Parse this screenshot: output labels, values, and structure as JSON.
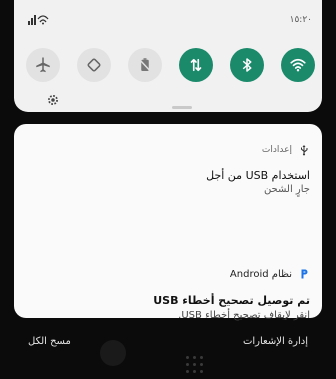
{
  "status_bar": {
    "signal_label": "ıl",
    "wifi_glyph": "📶",
    "time": "١٥:٢٠"
  },
  "quick_settings": {
    "tiles": [
      {
        "name": "airplane-mode",
        "state": "off"
      },
      {
        "name": "auto-rotate",
        "state": "off"
      },
      {
        "name": "battery-saver",
        "state": "off"
      },
      {
        "name": "mobile-data",
        "state": "on"
      },
      {
        "name": "bluetooth",
        "state": "on"
      },
      {
        "name": "wifi",
        "state": "on"
      }
    ],
    "accent_color": "#1b8a6b"
  },
  "notifications": {
    "usb": {
      "app_label": "إعدادات",
      "title": "استخدام USB من أجل",
      "subtitle": "جارٍ الشحن"
    },
    "debug": {
      "app_label": "نظام Android",
      "title": "تم توصيل تصحيح أخطاء USB",
      "subtitle": "انقر لإيقاف تصحيح أخطاء USB."
    }
  },
  "actions": {
    "clear_all": "مسح الكل",
    "manage": "إدارة الإشعارات"
  }
}
